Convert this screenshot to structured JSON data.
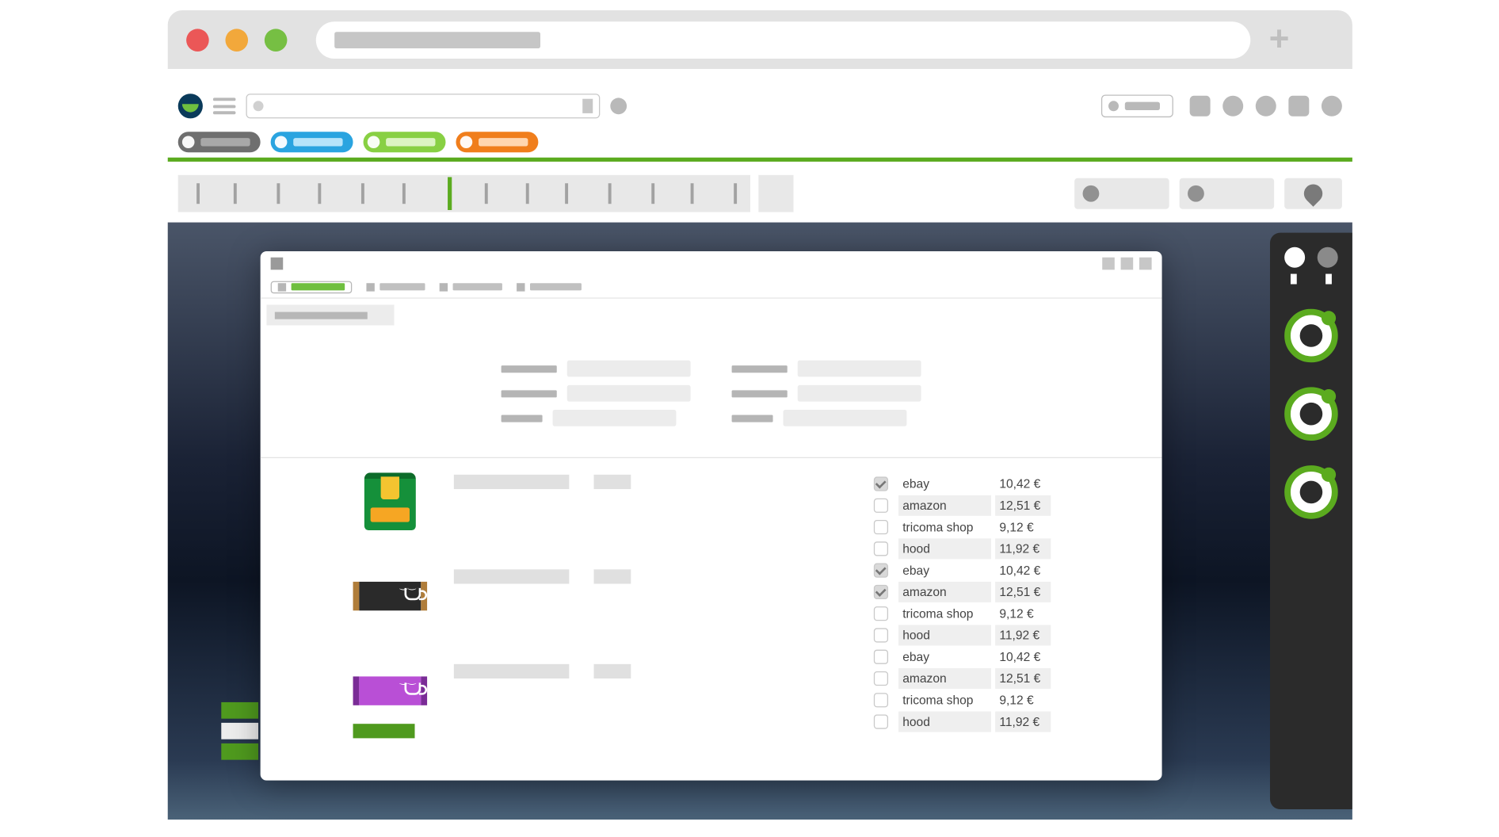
{
  "marketplace_rows": [
    {
      "name": "ebay",
      "price": "10,42 €",
      "checked": true
    },
    {
      "name": "amazon",
      "price": "12,51 €",
      "checked": false
    },
    {
      "name": "tricoma shop",
      "price": "9,12 €",
      "checked": false
    },
    {
      "name": "hood",
      "price": "11,92 €",
      "checked": false
    },
    {
      "name": "ebay",
      "price": "10,42 €",
      "checked": true
    },
    {
      "name": "amazon",
      "price": "12,51 €",
      "checked": true
    },
    {
      "name": "tricoma shop",
      "price": "9,12 €",
      "checked": false
    },
    {
      "name": "hood",
      "price": "11,92 €",
      "checked": false
    },
    {
      "name": "ebay",
      "price": "10,42 €",
      "checked": false
    },
    {
      "name": "amazon",
      "price": "12,51 €",
      "checked": false
    },
    {
      "name": "tricoma shop",
      "price": "9,12 €",
      "checked": false
    },
    {
      "name": "hood",
      "price": "11,92 €",
      "checked": false
    }
  ]
}
